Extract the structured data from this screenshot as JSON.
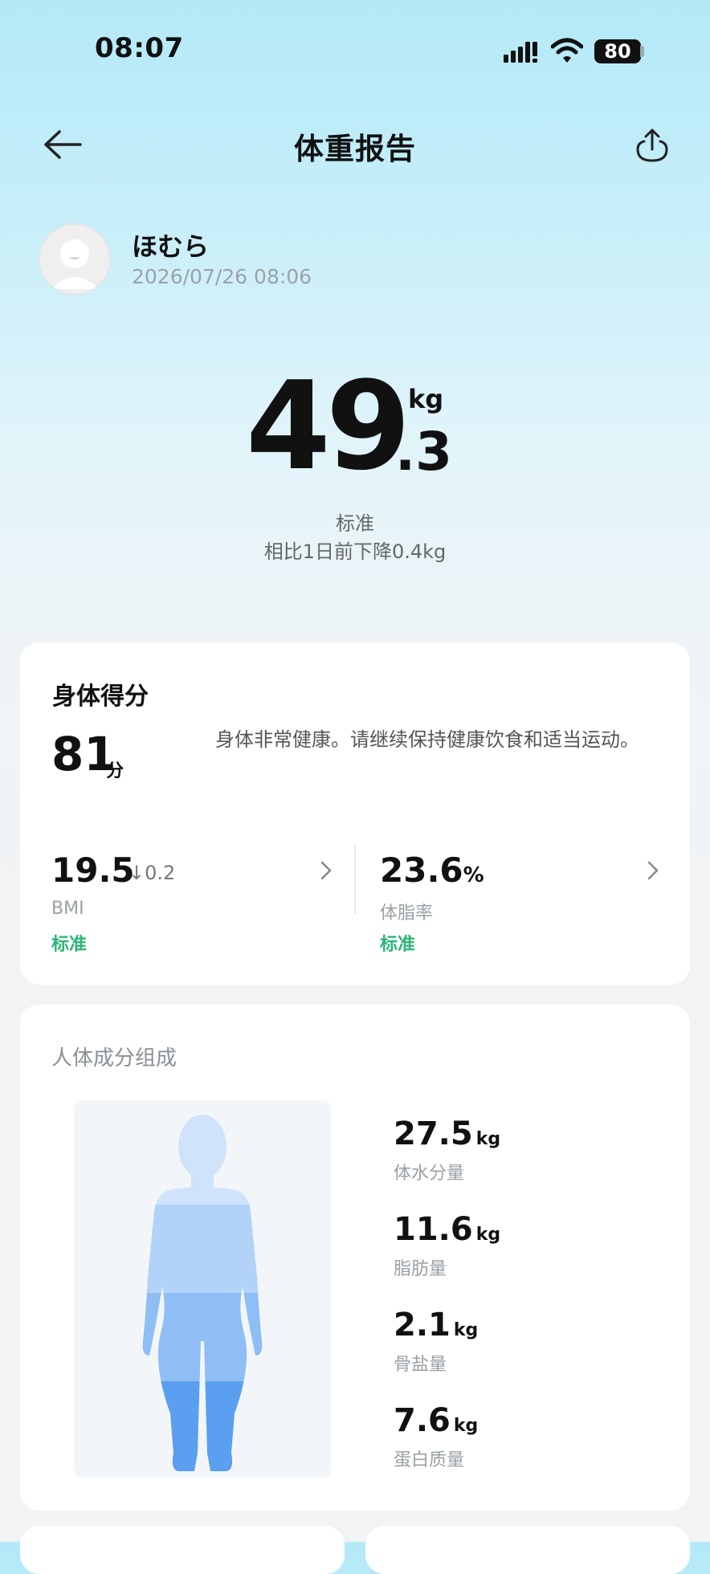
{
  "status_bar": {
    "time": "08:07",
    "battery": "80",
    "icons": [
      "signal-icon",
      "wifi-icon",
      "battery-icon"
    ]
  },
  "header": {
    "title": "体重报告",
    "icons": [
      "back-arrow-icon",
      "share-icon"
    ]
  },
  "profile": {
    "name": "ほむら",
    "datetime": "2026/07/26 08:06"
  },
  "weight": {
    "integer": "49",
    "decimal": ".3",
    "unit": "kg",
    "status": "标准",
    "change": "相比1日前下降0.4kg"
  },
  "score_card": {
    "title": "身体得分",
    "score": "81",
    "score_unit": "分",
    "description": "身体非常健康。请继续保持健康饮食和适当运动。",
    "bmi": {
      "value": "19.5",
      "delta": "↓0.2",
      "label": "BMI",
      "status": "标准"
    },
    "body_fat": {
      "value": "23.6",
      "unit": "%",
      "label": "体脂率",
      "status": "标准"
    },
    "status_color": "#2bb673"
  },
  "composition": {
    "title": "人体成分组成",
    "items": [
      {
        "value": "27.5",
        "unit": "kg",
        "label": "体水分量"
      },
      {
        "value": "11.6",
        "unit": "kg",
        "label": "脂肪量"
      },
      {
        "value": "2.1",
        "unit": "kg",
        "label": "骨盐量"
      },
      {
        "value": "7.6",
        "unit": "kg",
        "label": "蛋白质量"
      }
    ],
    "figure_colors": [
      "#cfe3fb",
      "#b2d2f8",
      "#8fbef5",
      "#5a9ff0"
    ]
  }
}
